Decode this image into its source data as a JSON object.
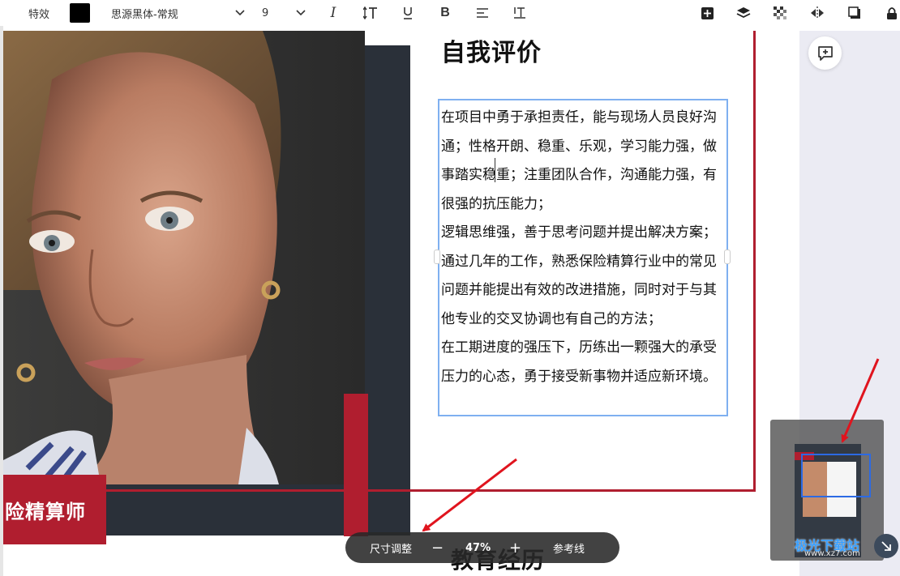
{
  "toolbar": {
    "effects_label": "特效",
    "text_color": "#000000",
    "font_family_value": "思源黑体-常规",
    "font_size_value": "9",
    "icons": [
      "italic-icon",
      "text-height-icon",
      "underline-icon",
      "bold-icon",
      "align-icon",
      "letter-spacing-icon",
      "add-element-icon",
      "layers-icon",
      "transparency-icon",
      "flip-icon",
      "shadow-icon",
      "lock-icon"
    ]
  },
  "resume": {
    "job_title": "险精算师",
    "section_title": "自我评价",
    "paragraphs": [
      "在项目中勇于承担责任，能与现场人员良好沟通；性格开朗、稳重、乐观，学习能力强，做事踏实稳重；注重团队合作，沟通能力强，有很强的抗压能力；",
      "逻辑思维强，善于思考问题并提出解决方案；",
      "通过几年的工作，熟悉保险精算行业中的常见问题并能提出有效的改进措施，同时对于与其他专业的交叉协调也有自己的方法；",
      "在工期进度的强压下，历练出一颗强大的承受压力的心态，勇于接受新事物并适应新环境。"
    ],
    "next_section_title": "教育经历"
  },
  "zoom_bar": {
    "size_adjust_label": "尺寸调整",
    "minus_label": "−",
    "zoom_percent": "47%",
    "plus_label": "+",
    "guides_label": "参考线"
  },
  "minimap": {
    "watermark": "极光下载站",
    "url": "www.xz7.com"
  },
  "colors": {
    "accent_red": "#b01e2f",
    "dark_panel": "#2a3039",
    "selection_blue": "#7fb0f0",
    "annotation_arrow": "#e0141e"
  }
}
